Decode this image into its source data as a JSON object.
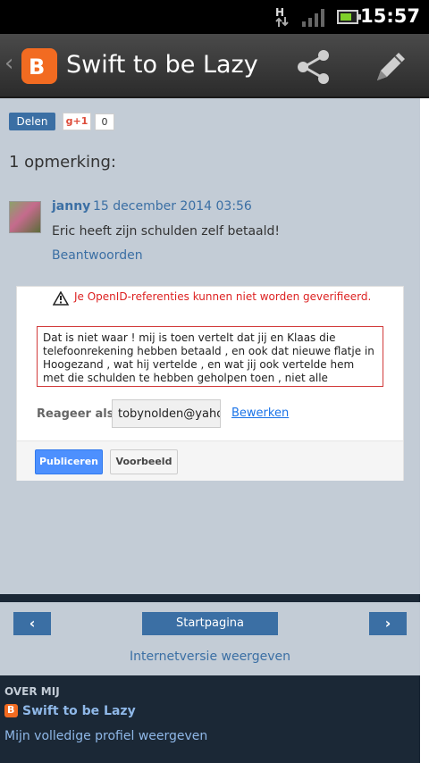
{
  "status_bar": {
    "time": "15:57",
    "network_label": "H"
  },
  "action_bar": {
    "logo_letter": "B",
    "title": "Swift to be Lazy",
    "back_glyph": "‹"
  },
  "share": {
    "delen_label": "Delen",
    "gplus_label": "g+1",
    "gplus_count": "0"
  },
  "comments": {
    "heading": "1 opmerking:",
    "items": [
      {
        "author": "janny",
        "date": "15 december 2014 03:56",
        "text": "Eric heeft zijn schulden zelf betaald!",
        "reply_label": "Beantwoorden"
      }
    ]
  },
  "form": {
    "warning": "Je OpenID-referenties kunnen niet worden geverifieerd.",
    "comment_text": "Dat is niet waar ! mij is toen vertelt dat jij en Klaas die telefoonrekening hebben betaald , en ook dat nieuwe flatje in Hoogezand , wat hij vertelde , en wat jij ook vertelde hem met die schulden te hebben geholpen toen , niet alle schulden , maar wel alle schulden",
    "reply_as_label": "Reageer als:",
    "identity_value": "tobynolden@yahoo",
    "edit_label": "Bewerken",
    "publish_label": "Publiceren",
    "preview_label": "Voorbeeld"
  },
  "nav": {
    "prev_label": "‹",
    "home_label": "Startpagina",
    "next_label": "›",
    "web_version_label": "Internetversie weergeven"
  },
  "footer": {
    "about_heading": "OVER MIJ",
    "logo_letter": "B",
    "blog_name": "Swift to be Lazy",
    "profile_link": "Mijn volledige profiel weergeven"
  },
  "colors": {
    "page_bg": "#c3ccd6",
    "accent_blue": "#3b6fa4",
    "blogger_orange": "#f26b21",
    "footer_bg": "#1b2836",
    "error_red": "#dd2222",
    "publish_blue": "#4d90fe"
  },
  "icons": {
    "back": "back-chevron-icon",
    "logo": "blogger-logo-icon",
    "share": "share-icon",
    "edit": "pencil-icon",
    "warning": "warning-triangle-icon",
    "signal": "signal-bars-icon",
    "battery": "battery-icon"
  }
}
